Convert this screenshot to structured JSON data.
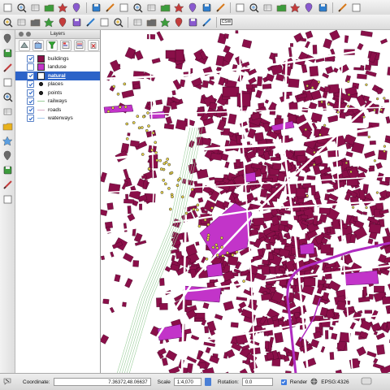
{
  "toolbar_top": {
    "icons": [
      "new-project",
      "open-project",
      "save-project",
      "save-as",
      "print-composer",
      "composer-manager",
      "pan",
      "pan-to-selection",
      "zoom-in",
      "zoom-out",
      "zoom-full",
      "zoom-selection",
      "zoom-layer",
      "zoom-last",
      "zoom-next",
      "refresh",
      "identify",
      "select-features",
      "deselect",
      "open-table",
      "measure",
      "map-tips",
      "bookmarks",
      "help",
      "python-console"
    ]
  },
  "toolbar_second": {
    "icons": [
      "edit-pencil",
      "save-edits",
      "add-feature",
      "move-feature",
      "node-tool",
      "delete-selected",
      "cut",
      "copy",
      "paste",
      "label-tool",
      "label-pin",
      "label-show",
      "label-move",
      "label-rotate",
      "label-change",
      "csw"
    ],
    "csw_label": "CSW"
  },
  "layers_panel": {
    "title": "Layers",
    "layers": [
      {
        "name": "buildings",
        "visible": true,
        "symbol": "fill",
        "color": "#8a0f49",
        "selected": false
      },
      {
        "name": "landuse",
        "visible": false,
        "symbol": "fill",
        "color": "#c234c9",
        "selected": false
      },
      {
        "name": "natural",
        "visible": true,
        "symbol": "fill",
        "color": "#ffffff",
        "selected": true
      },
      {
        "name": "places",
        "visible": true,
        "symbol": "point",
        "color": "#222222",
        "selected": false
      },
      {
        "name": "points",
        "visible": true,
        "symbol": "point",
        "color": "#222222",
        "selected": false
      },
      {
        "name": "railways",
        "visible": true,
        "symbol": "line",
        "color": "#9ccf9c",
        "selected": false
      },
      {
        "name": "roads",
        "visible": true,
        "symbol": "line",
        "color": "#d9b0c8",
        "selected": false
      },
      {
        "name": "waterways",
        "visible": true,
        "symbol": "line",
        "color": "#a5c8ea",
        "selected": false
      }
    ]
  },
  "status_bar": {
    "coordinate_label": "Coordinate:",
    "coordinate_value": "7.36372,48.06637",
    "scale_label": "Scale",
    "scale_value": "1:4,070",
    "rotation_label": "Rotation:",
    "rotation_value": "0.0",
    "render_label": "Render",
    "render_checked": true,
    "crs_label": "EPSG:4326"
  },
  "map": {
    "building_color": "#8a0f49",
    "landuse_color": "#c234c9",
    "road_color": "#ffffff",
    "railway_color": "#9ccf9c",
    "waterway_color": "#b02bc0"
  }
}
